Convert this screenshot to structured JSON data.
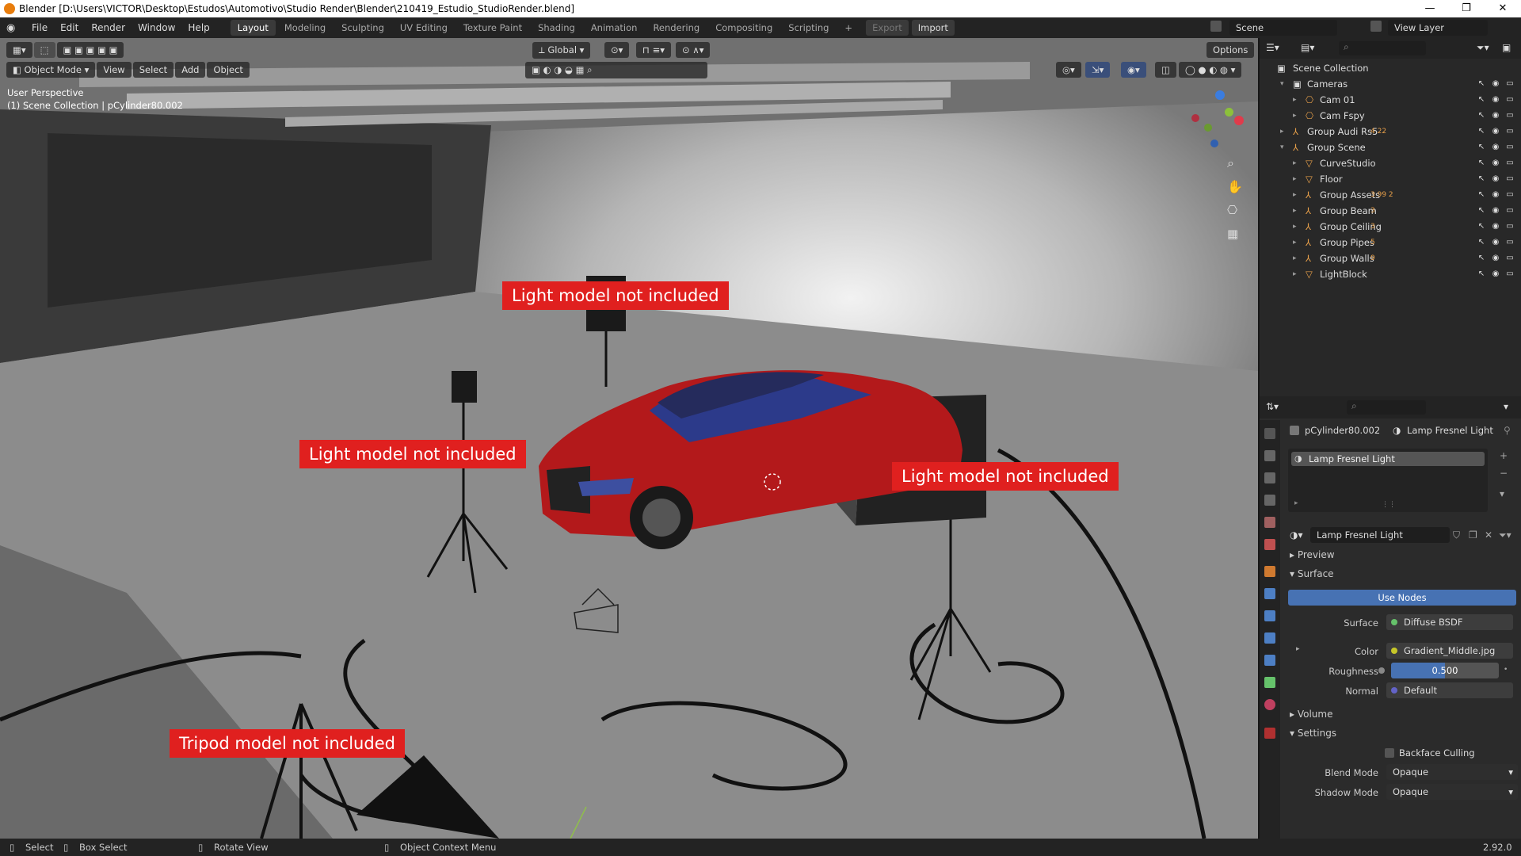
{
  "window": {
    "title": "Blender [D:\\Users\\VICTOR\\Desktop\\Estudos\\Automotivo\\Studio Render\\Blender\\210419_Estudio_StudioRender.blend]",
    "minimize": "—",
    "maximize": "❐",
    "close": "✕"
  },
  "menu": {
    "items": [
      "File",
      "Edit",
      "Render",
      "Window",
      "Help"
    ]
  },
  "workspaces": {
    "tabs": [
      "Layout",
      "Modeling",
      "Sculpting",
      "UV Editing",
      "Texture Paint",
      "Shading",
      "Animation",
      "Rendering",
      "Compositing",
      "Scripting"
    ],
    "active": "Layout",
    "add": "+",
    "export": "Export",
    "import": "Import"
  },
  "scene": {
    "label": "Scene",
    "view_layer": "View Layer"
  },
  "viewport": {
    "mode": "Object Mode",
    "view": "View",
    "select": "Select",
    "add": "Add",
    "object": "Object",
    "orientation": "Global",
    "options": "Options",
    "perspective": "User Perspective",
    "collection_info": "(1) Scene Collection | pCylinder80.002",
    "annotations": [
      "Light model not included",
      "Light model not included",
      "Light model not included",
      "Tripod model not included"
    ]
  },
  "outliner": {
    "root": "Scene Collection",
    "rows": [
      {
        "name": "Cameras",
        "expanded": true
      },
      {
        "name": "Cam 01"
      },
      {
        "name": "Cam Fspy"
      },
      {
        "name": "Group Audi Rs5",
        "badges": "4  22"
      },
      {
        "name": "Group Scene",
        "expanded": true
      },
      {
        "name": "CurveStudio"
      },
      {
        "name": "Floor"
      },
      {
        "name": "Group Assets",
        "badges": "3  99  2"
      },
      {
        "name": "Group Beam",
        "badges": "3"
      },
      {
        "name": "Group Ceiling",
        "badges": "3"
      },
      {
        "name": "Group Pipes",
        "badges": "5"
      },
      {
        "name": "Group Walls",
        "badges": "9"
      },
      {
        "name": "LightBlock"
      }
    ]
  },
  "properties": {
    "object": "pCylinder80.002",
    "material": "Lamp Fresnel Light",
    "slot": "Lamp Fresnel Light",
    "material_field": "Lamp Fresnel Light",
    "sections": {
      "preview": "Preview",
      "surface": "Surface",
      "volume": "Volume",
      "settings": "Settings"
    },
    "use_nodes": "Use Nodes",
    "surface_label": "Surface",
    "surface_value": "Diffuse BSDF",
    "color_label": "Color",
    "color_value": "Gradient_Middle.jpg",
    "roughness_label": "Roughness",
    "roughness_value": "0.500",
    "roughness_fraction": 0.5,
    "normal_label": "Normal",
    "normal_value": "Default",
    "backface_culling": "Backface Culling",
    "blend_mode_label": "Blend Mode",
    "blend_mode_value": "Opaque",
    "shadow_mode_label": "Shadow Mode",
    "shadow_mode_value": "Opaque"
  },
  "statusbar": {
    "select": "Select",
    "box_select": "Box Select",
    "rotate_view": "Rotate View",
    "context_menu": "Object Context Menu",
    "version": "2.92.0"
  },
  "colors": {
    "accent_blue": "#4772b3",
    "label_red": "#e0201f",
    "car_red": "#b3191b",
    "header": "#232323"
  }
}
